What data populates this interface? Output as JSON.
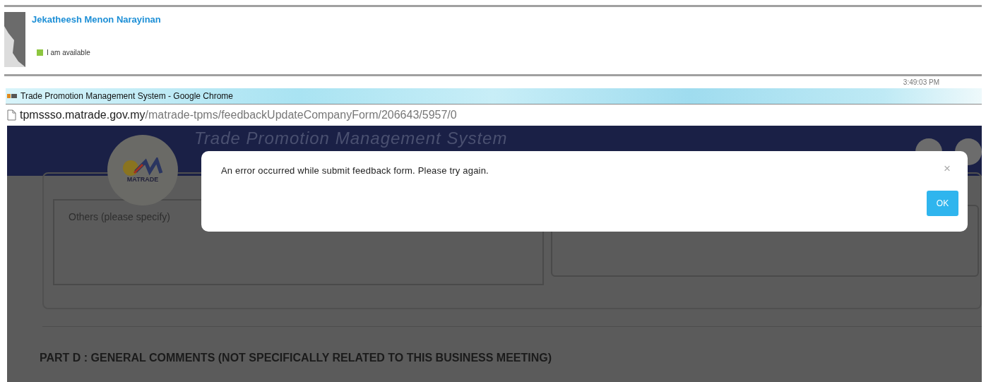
{
  "profile": {
    "name": "Jekatheesh Menon Narayinan",
    "status": "I am available"
  },
  "timestamp": "3:49:03 PM",
  "browser": {
    "title": "Trade Promotion Management System - Google Chrome",
    "url_host": "tpmssso.matrade.gov.my",
    "url_path": "/matrade-tpms/feedbackUpdateCompanyForm/206643/5957/0"
  },
  "page": {
    "header_title": "Trade Promotion Management System",
    "logo_text": "MATRADE",
    "field_label": "Others (please specify)",
    "section_heading": "PART D : GENERAL COMMENTS (NOT SPECIFICALLY RELATED TO THIS BUSINESS MEETING)"
  },
  "dialog": {
    "message": "An error occurred while submit feedback form. Please try again.",
    "close": "×",
    "button": "OK"
  }
}
